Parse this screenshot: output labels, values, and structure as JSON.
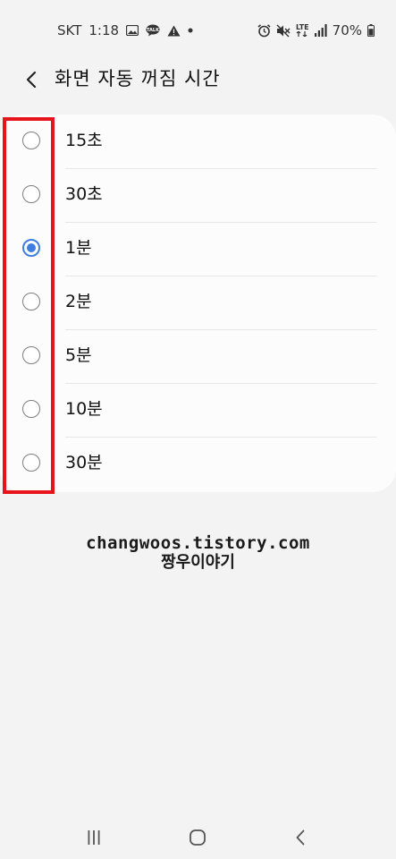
{
  "status_bar": {
    "carrier": "SKT",
    "time": "1:18",
    "network": "LTE",
    "battery": "70%",
    "icons_left": [
      "image-icon",
      "chat-icon",
      "warning-icon",
      "dot-icon"
    ],
    "icons_right": [
      "alarm-icon",
      "mute-icon",
      "lte-icon",
      "signal-icon",
      "battery-icon"
    ]
  },
  "header": {
    "title": "화면 자동 꺼짐 시간",
    "back_icon": "chevron-left-icon"
  },
  "options": [
    {
      "label": "15초",
      "selected": false
    },
    {
      "label": "30초",
      "selected": false
    },
    {
      "label": "1분",
      "selected": true
    },
    {
      "label": "2분",
      "selected": false
    },
    {
      "label": "5분",
      "selected": false
    },
    {
      "label": "10분",
      "selected": false
    },
    {
      "label": "30분",
      "selected": false
    }
  ],
  "watermark": {
    "line1": "changwoos.tistory.com",
    "line2": "짱우이야기"
  },
  "nav_bar": {
    "recents_icon": "recents-icon",
    "home_icon": "home-icon",
    "back_icon": "back-icon"
  },
  "colors": {
    "accent": "#3e7ee0",
    "highlight": "#e8141c",
    "background": "#f3f3f3",
    "card": "#fcfcfc"
  }
}
